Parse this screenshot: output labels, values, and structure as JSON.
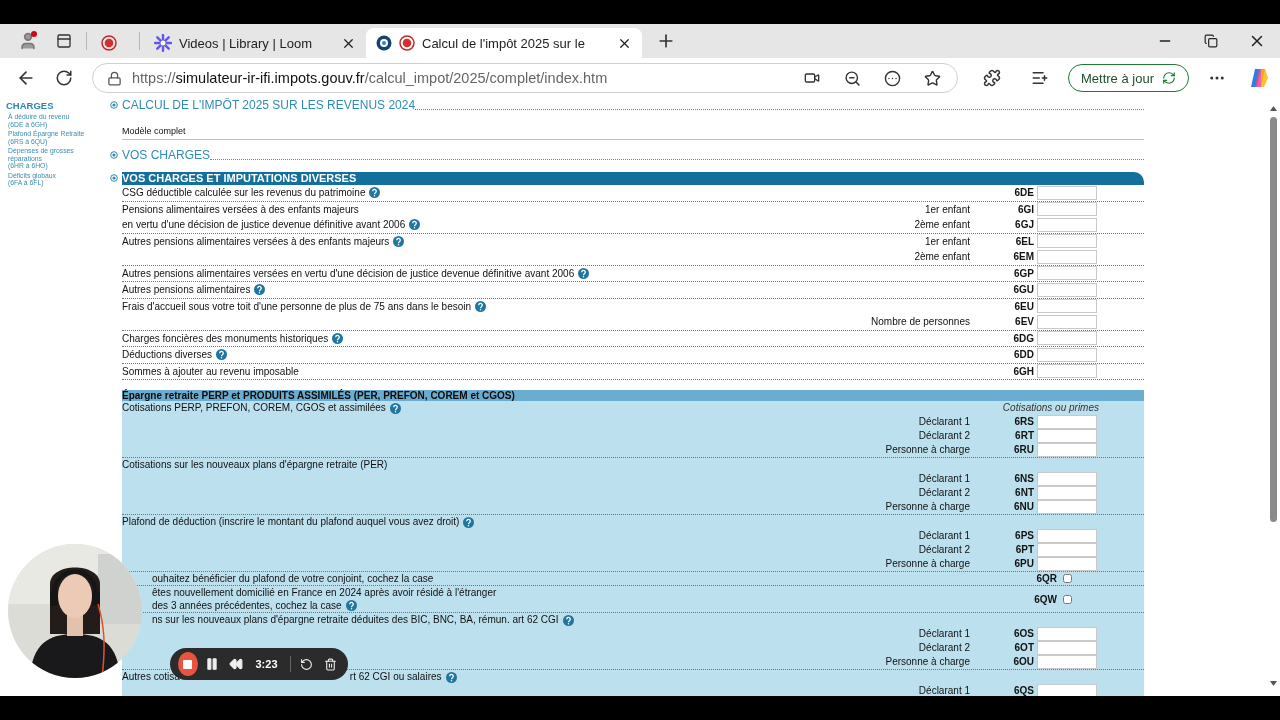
{
  "browser": {
    "tabs": [
      {
        "kind": "pinned",
        "selected": false
      },
      {
        "kind": "page",
        "title": "Videos | Library | Loom",
        "selected": false
      },
      {
        "kind": "page",
        "title": "Calcul de l'impôt 2025 sur le",
        "selected": true
      }
    ],
    "url": {
      "scheme": "https://",
      "host": "simulateur-ir-ifi.impots.gouv.fr",
      "path": "/calcul_impot/2025/complet/index.htm"
    },
    "update_button": "Mettre à jour"
  },
  "sidebar": {
    "title": "CHARGES",
    "items": [
      {
        "label": "À déduire du revenu",
        "range": "(6DE à 6GH)"
      },
      {
        "label": "Plafond Épargne Retraite",
        "range": "(6RS à 6QU)"
      },
      {
        "label": "Dépenses de grosses réparations",
        "range": "(6HR à 6HO)"
      },
      {
        "label": "Déficits globaux",
        "range": "(6FA à 6FL)"
      }
    ]
  },
  "form": {
    "title": "CALCUL DE L'IMPÔT 2025 SUR LES REVENUS 2024",
    "model": "Modèle complet",
    "section_title": "VOS CHARGES",
    "band": "VOS CHARGES ET IMPUTATIONS DIVERSES",
    "rows": [
      {
        "label": [
          "CSG déductible calculée sur les revenus du patrimoine"
        ],
        "help": true,
        "lines": [
          {
            "code": "6DE"
          }
        ]
      },
      {
        "label": [
          "Pensions alimentaires versées à des enfants majeurs",
          "en vertu d'une décision de justice devenue définitive avant 2006"
        ],
        "help": true,
        "lines": [
          {
            "sub": "1er enfant",
            "code": "6GI"
          },
          {
            "sub": "2ème enfant",
            "code": "6GJ"
          }
        ]
      },
      {
        "label": [
          "Autres pensions alimentaires versées à des enfants majeurs"
        ],
        "help": true,
        "lines": [
          {
            "sub": "1er enfant",
            "code": "6EL"
          },
          {
            "sub": "2ème enfant",
            "code": "6EM"
          }
        ]
      },
      {
        "label": [
          "Autres pensions alimentaires versées en vertu d'une décision de justice devenue définitive avant 2006"
        ],
        "help": true,
        "lines": [
          {
            "code": "6GP"
          }
        ]
      },
      {
        "label": [
          "Autres pensions alimentaires"
        ],
        "help": true,
        "lines": [
          {
            "code": "6GU"
          }
        ]
      },
      {
        "label": [
          "Frais d'accueil sous votre toit d'une personne de plus de 75 ans dans le besoin"
        ],
        "help": true,
        "lines": [
          {
            "code": "6EU"
          },
          {
            "sub": "Nombre de personnes",
            "code": "6EV"
          }
        ]
      },
      {
        "label": [
          "Charges foncières des monuments historiques"
        ],
        "help": true,
        "lines": [
          {
            "code": "6DG"
          }
        ]
      },
      {
        "label": [
          "Déductions diverses"
        ],
        "help": true,
        "lines": [
          {
            "code": "6DD"
          }
        ]
      },
      {
        "label": [
          "Sommes à ajouter au revenu imposable"
        ],
        "help": false,
        "lines": [
          {
            "code": "6GH"
          }
        ]
      }
    ],
    "retirement": {
      "title": "Épargne retraite PERP et PRODUITS ASSIMILÉS (PER, PREFON, COREM et CGOS)",
      "column_header": "Cotisations ou primes",
      "rows": [
        {
          "kind": "inputs",
          "label": [
            "Cotisations PERP, PREFON, COREM, CGOS et assimilées"
          ],
          "help": true,
          "lines": [
            {
              "sub": "Déclarant 1",
              "code": "6RS"
            },
            {
              "sub": "Déclarant 2",
              "code": "6RT"
            },
            {
              "sub": "Personne à charge",
              "code": "6RU"
            }
          ]
        },
        {
          "kind": "inputs",
          "label": [
            "Cotisations sur les nouveaux plans d'épargne retraite (PER)"
          ],
          "help": false,
          "lines": [
            {
              "sub": "Déclarant 1",
              "code": "6NS"
            },
            {
              "sub": "Déclarant 2",
              "code": "6NT"
            },
            {
              "sub": "Personne à charge",
              "code": "6NU"
            }
          ]
        },
        {
          "kind": "inputs",
          "label": [
            "Plafond de déduction (inscrire le montant du plafond auquel vous avez droit)"
          ],
          "help": true,
          "lines": [
            {
              "sub": "Déclarant 1",
              "code": "6PS"
            },
            {
              "sub": "Déclarant 2",
              "code": "6PT"
            },
            {
              "sub": "Personne à charge",
              "code": "6PU"
            }
          ]
        },
        {
          "kind": "checkbox",
          "label": [
            "ouhaitez bénéficier du plafond de votre conjoint, cochez la case"
          ],
          "partly_hidden": true,
          "help": false,
          "code": "6QR",
          "checked": false
        },
        {
          "kind": "checkbox",
          "label": [
            "êtes nouvellement domicilié en France en 2024 après avoir résidé à l'étranger",
            "des 3 années précédentes, cochez la case"
          ],
          "partly_hidden": true,
          "help": true,
          "code": "6QW",
          "checked": false
        },
        {
          "kind": "inputs",
          "label": [
            "ns sur les nouveaux plans d'épargne retraite déduites des BIC, BNC, BA, rémun. art 62 CGI"
          ],
          "partly_hidden": true,
          "help": true,
          "lines": [
            {
              "sub": "Déclarant 1",
              "code": "6OS"
            },
            {
              "sub": "Déclarant 2",
              "code": "6OT"
            },
            {
              "sub": "Personne à charge",
              "code": "6OU"
            }
          ]
        },
        {
          "kind": "inputs",
          "label": [
            "Autres cotisa"
          ],
          "tail": "rt 62 CGI ou salaires",
          "help": true,
          "lines": [
            {
              "sub": "Déclarant 1",
              "code": "6QS"
            }
          ]
        }
      ]
    }
  },
  "recorder": {
    "time": "3:23"
  }
}
